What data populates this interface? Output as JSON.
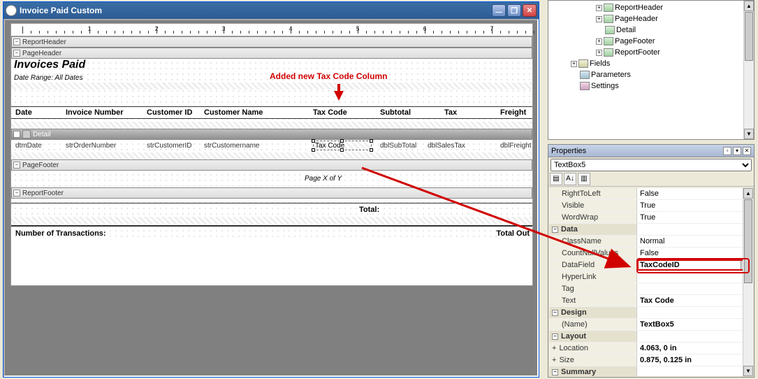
{
  "window": {
    "title": "Invoice Paid Custom"
  },
  "sections": {
    "reportHeader": "ReportHeader",
    "pageHeader": "PageHeader",
    "detail": "Detail",
    "pageFooter": "PageFooter",
    "reportFooter": "ReportFooter"
  },
  "pageHeader": {
    "title": "Invoices Paid",
    "daterange": "Date Range: All Dates",
    "columns": {
      "date": "Date",
      "invoiceNumber": "Invoice Number",
      "customerId": "Customer ID",
      "customerName": "Customer Name",
      "taxCode": "Tax Code",
      "subtotal": "Subtotal",
      "tax": "Tax",
      "freight": "Freight"
    }
  },
  "detail": {
    "fields": {
      "dtmDate": "dtmDate",
      "strOrderNumber": "strOrderNumber",
      "strCustomerID": "strCustomerID",
      "strCustomername": "strCustomername",
      "taxCode": "Tax Code",
      "dblSubTotal": "dblSubTotal",
      "dblSalesTax": "dblSalesTax",
      "dblFreight": "dblFreight"
    }
  },
  "pageFooter": {
    "pageXY": "Page       X   of    Y"
  },
  "reportFooter": {
    "total": "Total:",
    "numTrans": "Number of Transactions:",
    "totalOut": "Total Out"
  },
  "annotation": {
    "text": "Added new Tax Code Column"
  },
  "tree": {
    "items": [
      {
        "indent": 66,
        "pm": "+",
        "icon": "section",
        "label": "ReportHeader"
      },
      {
        "indent": 66,
        "pm": "+",
        "icon": "section",
        "label": "PageHeader"
      },
      {
        "indent": 66,
        "pm": "",
        "icon": "section",
        "label": "Detail"
      },
      {
        "indent": 66,
        "pm": "+",
        "icon": "section",
        "label": "PageFooter"
      },
      {
        "indent": 66,
        "pm": "+",
        "icon": "section",
        "label": "ReportFooter"
      },
      {
        "indent": 30,
        "pm": "+",
        "icon": "fields",
        "label": "Fields"
      },
      {
        "indent": 30,
        "pm": "",
        "icon": "params",
        "label": "Parameters"
      },
      {
        "indent": 30,
        "pm": "",
        "icon": "settings",
        "label": "Settings"
      }
    ]
  },
  "properties": {
    "title": "Properties",
    "object": "TextBox5",
    "rows": [
      {
        "cat": false,
        "k": "RightToLeft",
        "v": "False"
      },
      {
        "cat": false,
        "k": "Visible",
        "v": "True"
      },
      {
        "cat": false,
        "k": "WordWrap",
        "v": "True"
      },
      {
        "cat": true,
        "k": "Data",
        "v": ""
      },
      {
        "cat": false,
        "k": "ClassName",
        "v": "Normal"
      },
      {
        "cat": false,
        "k": "CountNullValues",
        "v": "False"
      },
      {
        "cat": false,
        "k": "DataField",
        "v": "TaxCodeID",
        "hl": true
      },
      {
        "cat": false,
        "k": "HyperLink",
        "v": ""
      },
      {
        "cat": false,
        "k": "Tag",
        "v": ""
      },
      {
        "cat": false,
        "k": "Text",
        "v": "Tax Code"
      },
      {
        "cat": true,
        "k": "Design",
        "v": ""
      },
      {
        "cat": false,
        "k": "(Name)",
        "v": "TextBox5"
      },
      {
        "cat": true,
        "k": "Layout",
        "v": ""
      },
      {
        "cat": false,
        "k": "Location",
        "v": "4.063, 0 in",
        "exp": true
      },
      {
        "cat": false,
        "k": "Size",
        "v": "0.875, 0.125 in",
        "exp": true
      },
      {
        "cat": true,
        "k": "Summary",
        "v": ""
      }
    ]
  }
}
